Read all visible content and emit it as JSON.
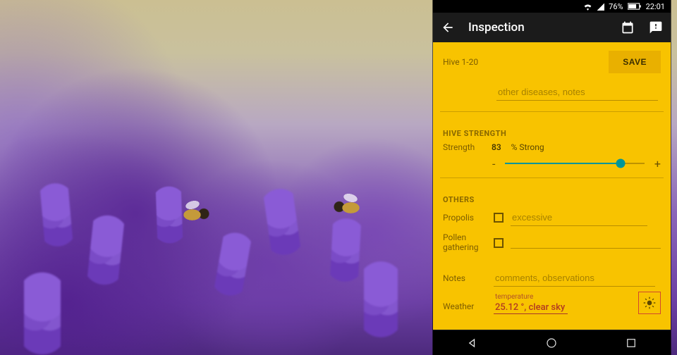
{
  "statusbar": {
    "battery_pct": "76%",
    "time": "22:01"
  },
  "appbar": {
    "title": "Inspection"
  },
  "subbar": {
    "hive_label": "Hive 1-20",
    "save_label": "SAVE"
  },
  "diseases": {
    "placeholder": "other diseases, notes"
  },
  "strength": {
    "section": "HIVE STRENGTH",
    "label": "Strength",
    "value": "83",
    "unit_label": "% Strong",
    "minus": "-",
    "plus": "+",
    "pct": 83
  },
  "others": {
    "section": "OTHERS",
    "propolis_label": "Propolis",
    "propolis_placeholder": "excessive",
    "pollen_label": "Pollen gathering"
  },
  "notes": {
    "label": "Notes",
    "placeholder": "comments, observations"
  },
  "weather": {
    "label": "Weather",
    "temp_caption": "temperature",
    "value": "25.12 °, clear sky"
  }
}
